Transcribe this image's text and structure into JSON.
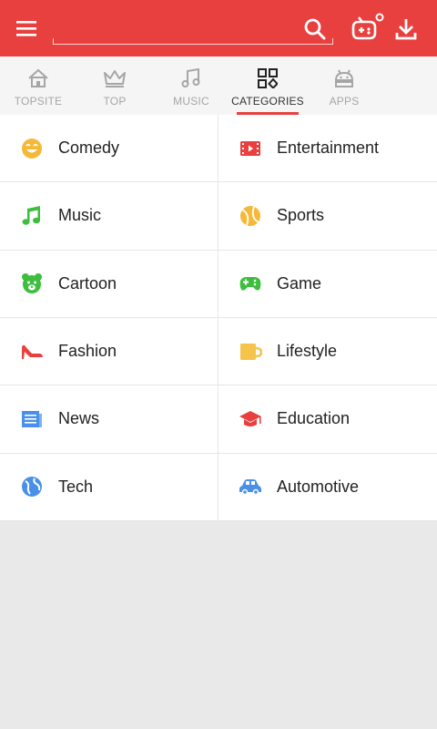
{
  "appbar": {
    "search_placeholder": "",
    "bg_color": "#e8403f"
  },
  "tabs": [
    {
      "label": "TOPSITE",
      "icon": "home-icon",
      "active": false
    },
    {
      "label": "TOP",
      "icon": "crown-icon",
      "active": false
    },
    {
      "label": "MUSIC",
      "icon": "music-note-icon",
      "active": false
    },
    {
      "label": "CATEGORIES",
      "icon": "categories-grid-icon",
      "active": true
    },
    {
      "label": "APPS",
      "icon": "android-icon",
      "active": false
    }
  ],
  "categories": [
    {
      "label": "Comedy",
      "icon": "smiley-icon",
      "color": "#f5b93a"
    },
    {
      "label": "Entertainment",
      "icon": "film-icon",
      "color": "#e8403f"
    },
    {
      "label": "Music",
      "icon": "music-note-icon",
      "color": "#3dbe3d"
    },
    {
      "label": "Sports",
      "icon": "tennis-ball-icon",
      "color": "#f5b93a"
    },
    {
      "label": "Cartoon",
      "icon": "bear-icon",
      "color": "#3dbe3d"
    },
    {
      "label": "Game",
      "icon": "gamepad-icon",
      "color": "#3dbe3d"
    },
    {
      "label": "Fashion",
      "icon": "high-heel-icon",
      "color": "#e8403f"
    },
    {
      "label": "Lifestyle",
      "icon": "mug-icon",
      "color": "#f5b93a"
    },
    {
      "label": "News",
      "icon": "newspaper-icon",
      "color": "#4a90e8"
    },
    {
      "label": "Education",
      "icon": "graduation-cap-icon",
      "color": "#e8403f"
    },
    {
      "label": "Tech",
      "icon": "globe-icon",
      "color": "#4a90e8"
    },
    {
      "label": "Automotive",
      "icon": "car-icon",
      "color": "#4a90e8"
    }
  ]
}
